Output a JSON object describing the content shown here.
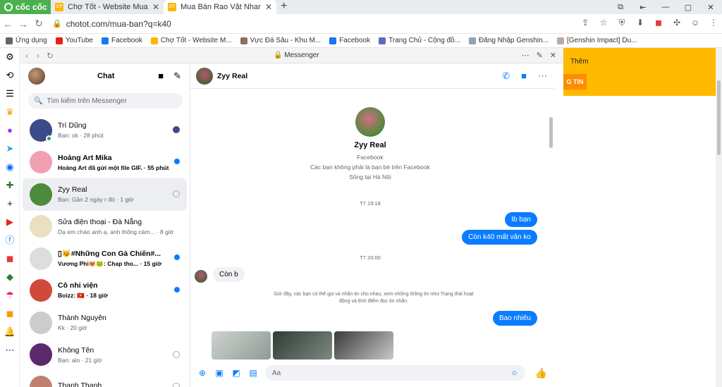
{
  "browser": {
    "logo": "cốc cốc",
    "tabs": [
      {
        "title": "Chợ Tốt - Website Mua Bán",
        "favicon": "chotot-icon"
      },
      {
        "title": "Mua Bán Rao Vặt Nhanh Ch",
        "favicon": "chotot-icon"
      }
    ],
    "url": "chotot.com/mua-ban?q=k40",
    "bookmarks": [
      "Ứng dụng",
      "YouTube",
      "Facebook",
      "Chợ Tốt - Website M...",
      "Vực Đá Sâu - Khu M...",
      "Facebook",
      "Trang Chủ - Cộng đồ...",
      "Đăng Nhập Genshin...",
      "[Genshin Impact] Du..."
    ]
  },
  "panel": {
    "title": "Messenger"
  },
  "chatlist": {
    "title": "Chat",
    "search_placeholder": "Tìm kiếm trên Messenger",
    "items": [
      {
        "name": "Trí Dũng",
        "preview": "Bạn: ok · 28 phút",
        "unread": false,
        "status": "avatar-seen",
        "online": true,
        "avatar_color": "#3a4a8a"
      },
      {
        "name": "Hoàng Art Mika",
        "preview": "Hoàng Art đã gửi một file GIF. · 55 phút",
        "unread": true,
        "status": "dot",
        "online": false,
        "avatar_color": "#f0a0b0"
      },
      {
        "name": "Zyy Real",
        "preview": "Bạn: Gần 2 ngày r đó · 1 giờ",
        "unread": false,
        "status": "seen",
        "online": false,
        "avatar_color": "#4d8a3b"
      },
      {
        "name": "Sửa điện thoại - Đà Nẵng",
        "preview": "Dạ em chào anh ạ, anh thông cảm... · 8 giờ",
        "unread": false,
        "status": "none",
        "online": false,
        "avatar_color": "#e8e0c0"
      },
      {
        "name": "▯😼#Những Con Gà Chiến#...",
        "preview": "Vương Phi😻🐸: Chap tho... · 15 giờ",
        "unread": true,
        "status": "dot",
        "online": false,
        "avatar_color": "#dddddd"
      },
      {
        "name": "Cô nhi viện",
        "preview": "Boizz: 🇻🇳 · 18 giờ",
        "unread": true,
        "status": "dot",
        "online": false,
        "avatar_color": "#d04a3a"
      },
      {
        "name": "Thành Nguyên",
        "preview": "Kk · 20 giờ",
        "unread": false,
        "status": "none",
        "online": false,
        "avatar_color": "#cccccc"
      },
      {
        "name": "Không Tên",
        "preview": "Bạn: alo · 21 giờ",
        "unread": false,
        "status": "seen",
        "online": false,
        "avatar_color": "#5a2a6a"
      },
      {
        "name": "Thanh Thanh",
        "preview": "",
        "unread": false,
        "status": "seen",
        "online": false,
        "avatar_color": "#c08070"
      }
    ]
  },
  "conversation": {
    "name": "Zyy Real",
    "profile": {
      "name": "Zyy Real",
      "line1": "Facebook",
      "line2": "Các bạn không phải là bạn bè trên Facebook",
      "line3": "Sống tại Hà Nội"
    },
    "ts1": "T7 19:18",
    "out1": "Ib bạn",
    "out2": "Còn k40 mất vân ko",
    "ts2": "T7 20:00",
    "in1": "Còn b",
    "notice": "Giờ đây, các bạn có thể gọi và nhắn tin cho nhau, xem những thông tin như Trạng thái hoạt động và thời điểm đọc tin nhắn.",
    "out3": "Bao nhiêu",
    "composer_placeholder": "Aa"
  },
  "right": {
    "more": "Thêm",
    "button": "G TIN"
  }
}
